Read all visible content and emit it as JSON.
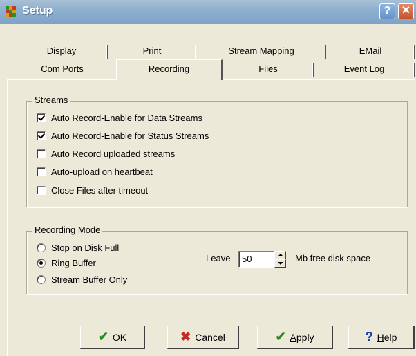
{
  "window": {
    "title": "Setup",
    "help_glyph": "?",
    "close_glyph": "✕"
  },
  "tabs": {
    "row1": [
      "Display",
      "Print",
      "Stream Mapping",
      "EMail"
    ],
    "row2": [
      "Com Ports",
      "Recording",
      "Files",
      "Event Log"
    ],
    "active": "Recording"
  },
  "streams": {
    "legend": "Streams",
    "items": [
      {
        "pre": "Auto Record-Enable for ",
        "u": "D",
        "post": "ata Streams",
        "checked": true
      },
      {
        "pre": "Auto Record-Enable for ",
        "u": "S",
        "post": "tatus Streams",
        "checked": true
      },
      {
        "pre": "Auto Record uploaded streams",
        "u": "",
        "post": "",
        "checked": false
      },
      {
        "pre": "Auto-upload on heartbeat",
        "u": "",
        "post": "",
        "checked": false
      },
      {
        "pre": "Close Files after timeout",
        "u": "",
        "post": "",
        "checked": false
      }
    ]
  },
  "recording_mode": {
    "legend": "Recording Mode",
    "options": [
      {
        "label": "Stop on Disk Full",
        "selected": false
      },
      {
        "label": "Ring Buffer",
        "selected": true
      },
      {
        "label": "Stream Buffer Only",
        "selected": false
      }
    ],
    "leave_label": "Leave",
    "leave_value": "50",
    "unit_label": "Mb free disk space"
  },
  "buttons": {
    "ok": {
      "label": "OK",
      "icon": "check-icon"
    },
    "cancel": {
      "label": "Cancel",
      "icon": "x-icon"
    },
    "apply": {
      "pre": "",
      "u": "A",
      "post": "pply",
      "icon": "check-icon"
    },
    "help": {
      "pre": "",
      "u": "H",
      "post": "elp",
      "icon": "question-icon"
    }
  },
  "colors": {
    "check_green": "#2a8a1e",
    "cancel_red": "#c8281e",
    "help_blue": "#1f3fb0"
  }
}
